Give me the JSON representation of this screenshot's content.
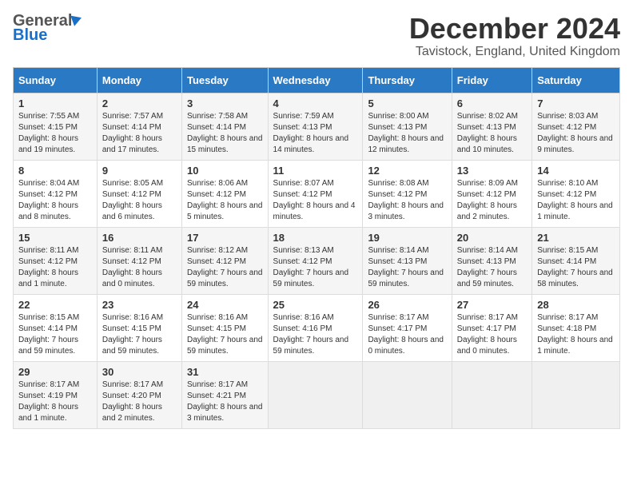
{
  "logo": {
    "general": "General",
    "blue": "Blue"
  },
  "header": {
    "month": "December 2024",
    "location": "Tavistock, England, United Kingdom"
  },
  "weekdays": [
    "Sunday",
    "Monday",
    "Tuesday",
    "Wednesday",
    "Thursday",
    "Friday",
    "Saturday"
  ],
  "weeks": [
    [
      {
        "day": "1",
        "sunrise": "Sunrise: 7:55 AM",
        "sunset": "Sunset: 4:15 PM",
        "daylight": "Daylight: 8 hours and 19 minutes."
      },
      {
        "day": "2",
        "sunrise": "Sunrise: 7:57 AM",
        "sunset": "Sunset: 4:14 PM",
        "daylight": "Daylight: 8 hours and 17 minutes."
      },
      {
        "day": "3",
        "sunrise": "Sunrise: 7:58 AM",
        "sunset": "Sunset: 4:14 PM",
        "daylight": "Daylight: 8 hours and 15 minutes."
      },
      {
        "day": "4",
        "sunrise": "Sunrise: 7:59 AM",
        "sunset": "Sunset: 4:13 PM",
        "daylight": "Daylight: 8 hours and 14 minutes."
      },
      {
        "day": "5",
        "sunrise": "Sunrise: 8:00 AM",
        "sunset": "Sunset: 4:13 PM",
        "daylight": "Daylight: 8 hours and 12 minutes."
      },
      {
        "day": "6",
        "sunrise": "Sunrise: 8:02 AM",
        "sunset": "Sunset: 4:13 PM",
        "daylight": "Daylight: 8 hours and 10 minutes."
      },
      {
        "day": "7",
        "sunrise": "Sunrise: 8:03 AM",
        "sunset": "Sunset: 4:12 PM",
        "daylight": "Daylight: 8 hours and 9 minutes."
      }
    ],
    [
      {
        "day": "8",
        "sunrise": "Sunrise: 8:04 AM",
        "sunset": "Sunset: 4:12 PM",
        "daylight": "Daylight: 8 hours and 8 minutes."
      },
      {
        "day": "9",
        "sunrise": "Sunrise: 8:05 AM",
        "sunset": "Sunset: 4:12 PM",
        "daylight": "Daylight: 8 hours and 6 minutes."
      },
      {
        "day": "10",
        "sunrise": "Sunrise: 8:06 AM",
        "sunset": "Sunset: 4:12 PM",
        "daylight": "Daylight: 8 hours and 5 minutes."
      },
      {
        "day": "11",
        "sunrise": "Sunrise: 8:07 AM",
        "sunset": "Sunset: 4:12 PM",
        "daylight": "Daylight: 8 hours and 4 minutes."
      },
      {
        "day": "12",
        "sunrise": "Sunrise: 8:08 AM",
        "sunset": "Sunset: 4:12 PM",
        "daylight": "Daylight: 8 hours and 3 minutes."
      },
      {
        "day": "13",
        "sunrise": "Sunrise: 8:09 AM",
        "sunset": "Sunset: 4:12 PM",
        "daylight": "Daylight: 8 hours and 2 minutes."
      },
      {
        "day": "14",
        "sunrise": "Sunrise: 8:10 AM",
        "sunset": "Sunset: 4:12 PM",
        "daylight": "Daylight: 8 hours and 1 minute."
      }
    ],
    [
      {
        "day": "15",
        "sunrise": "Sunrise: 8:11 AM",
        "sunset": "Sunset: 4:12 PM",
        "daylight": "Daylight: 8 hours and 1 minute."
      },
      {
        "day": "16",
        "sunrise": "Sunrise: 8:11 AM",
        "sunset": "Sunset: 4:12 PM",
        "daylight": "Daylight: 8 hours and 0 minutes."
      },
      {
        "day": "17",
        "sunrise": "Sunrise: 8:12 AM",
        "sunset": "Sunset: 4:12 PM",
        "daylight": "Daylight: 7 hours and 59 minutes."
      },
      {
        "day": "18",
        "sunrise": "Sunrise: 8:13 AM",
        "sunset": "Sunset: 4:12 PM",
        "daylight": "Daylight: 7 hours and 59 minutes."
      },
      {
        "day": "19",
        "sunrise": "Sunrise: 8:14 AM",
        "sunset": "Sunset: 4:13 PM",
        "daylight": "Daylight: 7 hours and 59 minutes."
      },
      {
        "day": "20",
        "sunrise": "Sunrise: 8:14 AM",
        "sunset": "Sunset: 4:13 PM",
        "daylight": "Daylight: 7 hours and 59 minutes."
      },
      {
        "day": "21",
        "sunrise": "Sunrise: 8:15 AM",
        "sunset": "Sunset: 4:14 PM",
        "daylight": "Daylight: 7 hours and 58 minutes."
      }
    ],
    [
      {
        "day": "22",
        "sunrise": "Sunrise: 8:15 AM",
        "sunset": "Sunset: 4:14 PM",
        "daylight": "Daylight: 7 hours and 59 minutes."
      },
      {
        "day": "23",
        "sunrise": "Sunrise: 8:16 AM",
        "sunset": "Sunset: 4:15 PM",
        "daylight": "Daylight: 7 hours and 59 minutes."
      },
      {
        "day": "24",
        "sunrise": "Sunrise: 8:16 AM",
        "sunset": "Sunset: 4:15 PM",
        "daylight": "Daylight: 7 hours and 59 minutes."
      },
      {
        "day": "25",
        "sunrise": "Sunrise: 8:16 AM",
        "sunset": "Sunset: 4:16 PM",
        "daylight": "Daylight: 7 hours and 59 minutes."
      },
      {
        "day": "26",
        "sunrise": "Sunrise: 8:17 AM",
        "sunset": "Sunset: 4:17 PM",
        "daylight": "Daylight: 8 hours and 0 minutes."
      },
      {
        "day": "27",
        "sunrise": "Sunrise: 8:17 AM",
        "sunset": "Sunset: 4:17 PM",
        "daylight": "Daylight: 8 hours and 0 minutes."
      },
      {
        "day": "28",
        "sunrise": "Sunrise: 8:17 AM",
        "sunset": "Sunset: 4:18 PM",
        "daylight": "Daylight: 8 hours and 1 minute."
      }
    ],
    [
      {
        "day": "29",
        "sunrise": "Sunrise: 8:17 AM",
        "sunset": "Sunset: 4:19 PM",
        "daylight": "Daylight: 8 hours and 1 minute."
      },
      {
        "day": "30",
        "sunrise": "Sunrise: 8:17 AM",
        "sunset": "Sunset: 4:20 PM",
        "daylight": "Daylight: 8 hours and 2 minutes."
      },
      {
        "day": "31",
        "sunrise": "Sunrise: 8:17 AM",
        "sunset": "Sunset: 4:21 PM",
        "daylight": "Daylight: 8 hours and 3 minutes."
      },
      null,
      null,
      null,
      null
    ]
  ]
}
